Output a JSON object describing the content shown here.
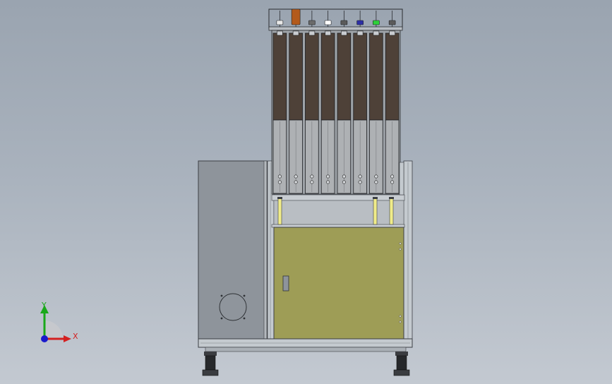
{
  "triad": {
    "x_label": "X",
    "y_label": "Y",
    "x_color": "#d42020",
    "y_color": "#1aa81a",
    "z_color": "#1a1acc"
  },
  "colors": {
    "cabinet_panel": "#8e949b",
    "door_panel": "#9e9d56",
    "frame": "#c4cacf",
    "magazine_top": "#4e4138",
    "magazine_bottom": "#aeb1b4",
    "sensor": "#f0ec8a"
  },
  "magazines": {
    "slot_count": 8,
    "top_items": [
      {
        "name": "bin-slot-1",
        "color": "#e8e8e8"
      },
      {
        "name": "bin-slot-2",
        "color": "#b35a1c"
      },
      {
        "name": "bin-slot-3",
        "color": "#6b6b6b"
      },
      {
        "name": "bin-slot-4",
        "color": "#ffffff"
      },
      {
        "name": "bin-slot-5",
        "color": "#5b5b5b"
      },
      {
        "name": "bin-slot-6",
        "color": "#2d2fa6"
      },
      {
        "name": "bin-slot-7",
        "color": "#2fd13a"
      },
      {
        "name": "bin-slot-8",
        "color": "#5b5b5b"
      }
    ]
  }
}
